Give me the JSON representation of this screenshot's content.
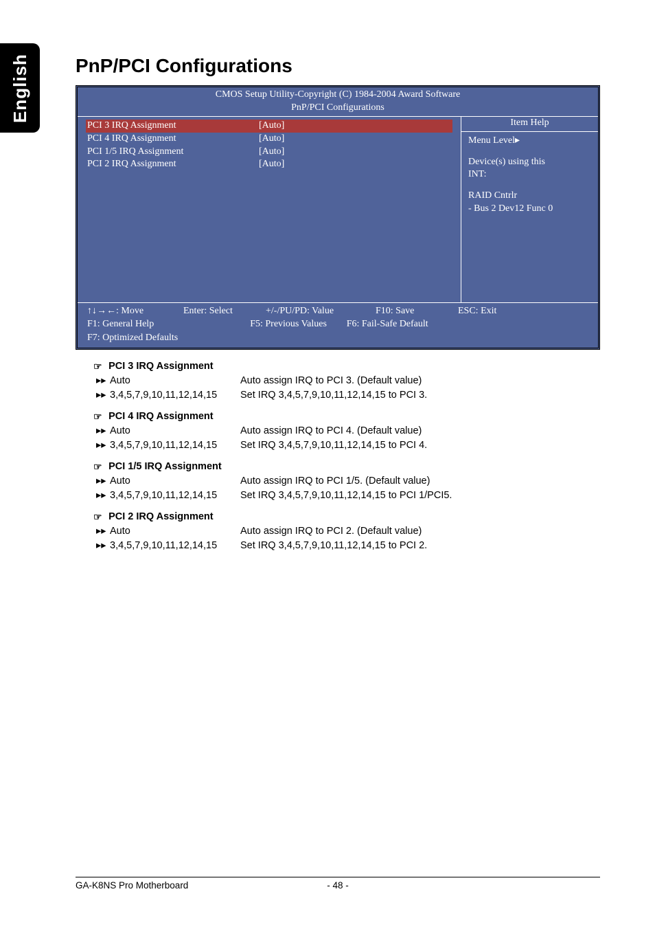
{
  "side_tab": "English",
  "page_title": "PnP/PCI Configurations",
  "bios": {
    "header_line1": "CMOS Setup Utility-Copyright (C) 1984-2004 Award Software",
    "header_line2": "PnP/PCI Configurations",
    "rows": [
      {
        "label": "PCI 3 IRQ Assignment",
        "value": "[Auto]",
        "highlight": true
      },
      {
        "label": "PCI 4 IRQ Assignment",
        "value": "[Auto]",
        "highlight": false
      },
      {
        "label": "PCI 1/5 IRQ Assignment",
        "value": "[Auto]",
        "highlight": false
      },
      {
        "label": "PCI 2 IRQ Assignment",
        "value": "[Auto]",
        "highlight": false
      }
    ],
    "help_title": "Item Help",
    "menu_level": "Menu Level▸",
    "help_line1": "Device(s) using this",
    "help_line2": "INT:",
    "help_line3": "RAID Cntrlr",
    "help_line4": "- Bus 2 Dev12 Func 0",
    "footer": {
      "move": "↑↓→←: Move",
      "enter": "Enter: Select",
      "pupd": "+/-/PU/PD: Value",
      "f10": "F10: Save",
      "esc": "ESC: Exit",
      "f1": "F1: General Help",
      "f5": "F5: Previous Values",
      "f6": "F6: Fail-Safe Default",
      "f7": "F7: Optimized Defaults"
    }
  },
  "sections": [
    {
      "title": "PCI 3 IRQ Assignment",
      "items": [
        {
          "key": "Auto",
          "desc": "Auto assign IRQ to PCI 3. (Default value)"
        },
        {
          "key": "3,4,5,7,9,10,11,12,14,15",
          "desc": "Set IRQ 3,4,5,7,9,10,11,12,14,15 to PCI 3."
        }
      ]
    },
    {
      "title": "PCI 4 IRQ Assignment",
      "items": [
        {
          "key": "Auto",
          "desc": "Auto assign IRQ to PCI 4. (Default value)"
        },
        {
          "key": "3,4,5,7,9,10,11,12,14,15",
          "desc": "Set IRQ 3,4,5,7,9,10,11,12,14,15 to PCI 4."
        }
      ]
    },
    {
      "title": "PCI 1/5 IRQ Assignment",
      "items": [
        {
          "key": "Auto",
          "desc": "Auto assign IRQ to PCI 1/5. (Default value)"
        },
        {
          "key": "3,4,5,7,9,10,11,12,14,15",
          "desc": "Set IRQ 3,4,5,7,9,10,11,12,14,15 to PCI 1/PCI5."
        }
      ]
    },
    {
      "title": "PCI 2 IRQ Assignment",
      "items": [
        {
          "key": "Auto",
          "desc": "Auto assign IRQ to PCI 2. (Default value)"
        },
        {
          "key": "3,4,5,7,9,10,11,12,14,15",
          "desc": "Set IRQ 3,4,5,7,9,10,11,12,14,15 to PCI 2."
        }
      ]
    }
  ],
  "footer": {
    "left": "GA-K8NS Pro Motherboard",
    "center": "- 48 -"
  },
  "glyphs": {
    "hand": "☞",
    "arrows": "▸▸"
  }
}
